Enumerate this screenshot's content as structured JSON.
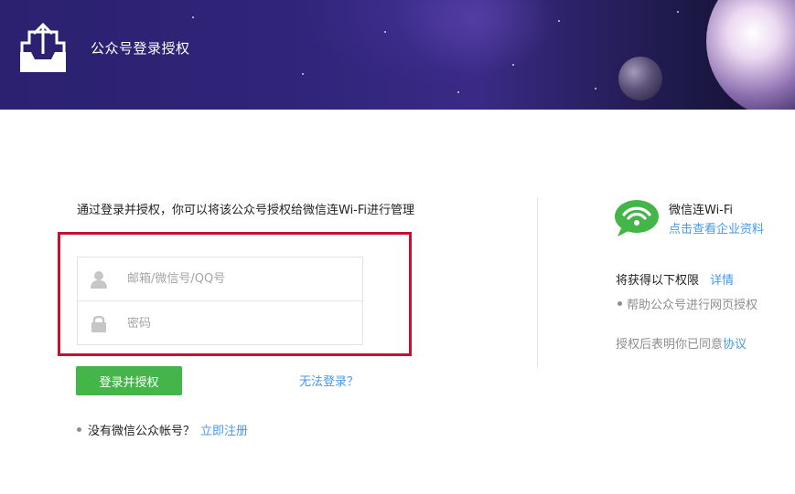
{
  "header": {
    "title": "公众号登录授权",
    "logo_icon": "upload-tray-icon"
  },
  "main": {
    "intro_text": "通过登录并授权，你可以将该公众号授权给微信连Wi-Fi进行管理",
    "username": {
      "placeholder": "邮箱/微信号/QQ号",
      "value": "",
      "icon": "user-icon"
    },
    "password": {
      "placeholder": "密码",
      "value": "",
      "icon": "lock-icon"
    },
    "login_button": "登录并授权",
    "cant_login_link": "无法登录？",
    "no_account_text": "没有微信公众帐号？",
    "register_link": "立即注册"
  },
  "side": {
    "app_icon": "wifi-chat-icon",
    "app_name": "微信连Wi-Fi",
    "company_link": "点击查看企业资料",
    "permissions_title": "将获得以下权限",
    "permissions_detail_link": "详情",
    "permissions": [
      "帮助公众号进行网页授权"
    ],
    "agree_text": "授权后表明你已同意",
    "agree_link": "协议"
  },
  "colors": {
    "accent_green": "#44b549",
    "link_blue": "#459ae9",
    "highlight_red": "#c8102e",
    "header_purple": "#2f2478"
  }
}
